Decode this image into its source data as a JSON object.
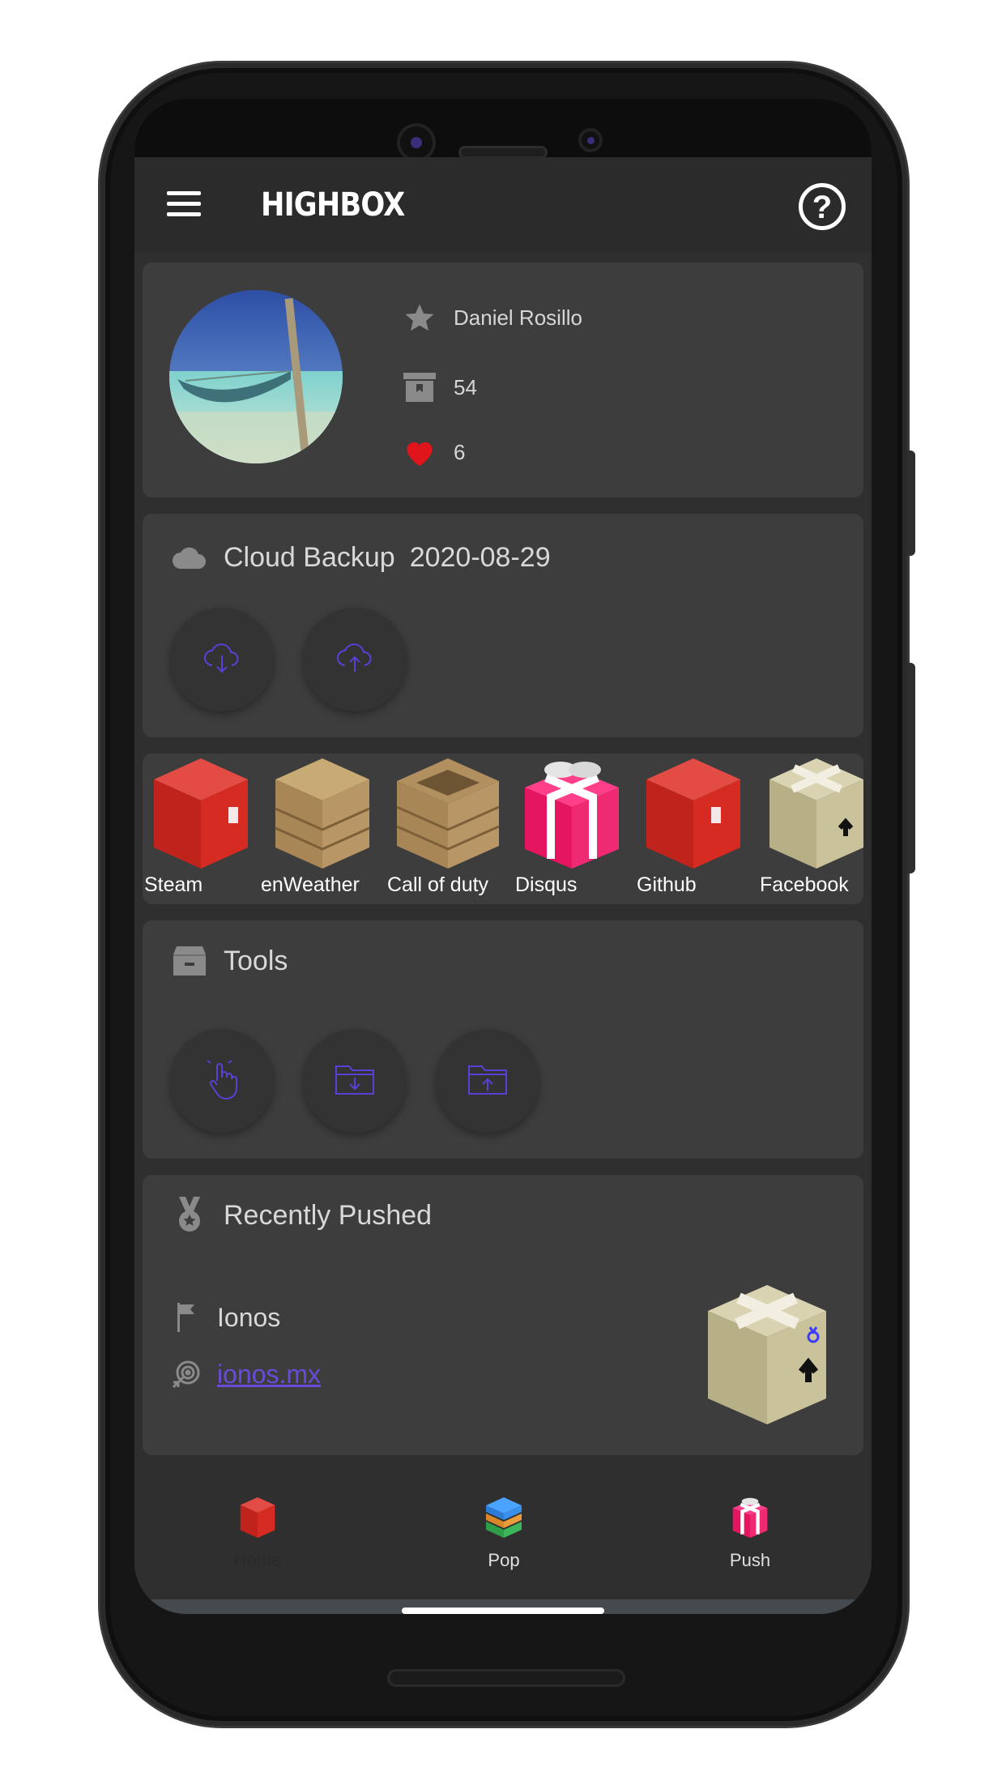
{
  "app": {
    "title": "HIGHBOX",
    "menu_icon": "hamburger-menu-icon",
    "help_icon": "help-circle-icon"
  },
  "profile": {
    "name": "Daniel Rosillo",
    "boxes_count": "54",
    "likes_count": "6",
    "icons": [
      "star-icon",
      "archive-box-icon",
      "heart-icon"
    ],
    "heart_color": "#e0151b"
  },
  "cloud_backup": {
    "label": "Cloud Backup",
    "date": "2020-08-29",
    "buttons": [
      "cloud-download-icon",
      "cloud-upload-icon"
    ]
  },
  "boxes": [
    {
      "label": "Steam",
      "icon": "red-chest-icon"
    },
    {
      "label": "enWeather",
      "icon": "wooden-crate-icon"
    },
    {
      "label": "Call of duty",
      "icon": "open-wooden-crate-icon"
    },
    {
      "label": "Disqus",
      "icon": "gift-box-icon"
    },
    {
      "label": "Github",
      "icon": "red-chest-icon"
    },
    {
      "label": "Facebook",
      "icon": "cardboard-box-icon"
    }
  ],
  "tools": {
    "label": "Tools",
    "buttons": [
      "tap-hand-icon",
      "folder-download-icon",
      "folder-upload-icon"
    ]
  },
  "recently_pushed": {
    "label": "Recently Pushed",
    "item_name": "Ionos",
    "item_link": "ionos.mx"
  },
  "bottom_nav": [
    {
      "label": "Home",
      "icon": "red-chest-icon"
    },
    {
      "label": "Pop",
      "icon": "stacked-boxes-icon"
    },
    {
      "label": "Push",
      "icon": "gift-box-icon"
    }
  ],
  "colors": {
    "accent": "#5b3fd6",
    "card": "#3d3d3d",
    "background": "#2f2f2f"
  }
}
